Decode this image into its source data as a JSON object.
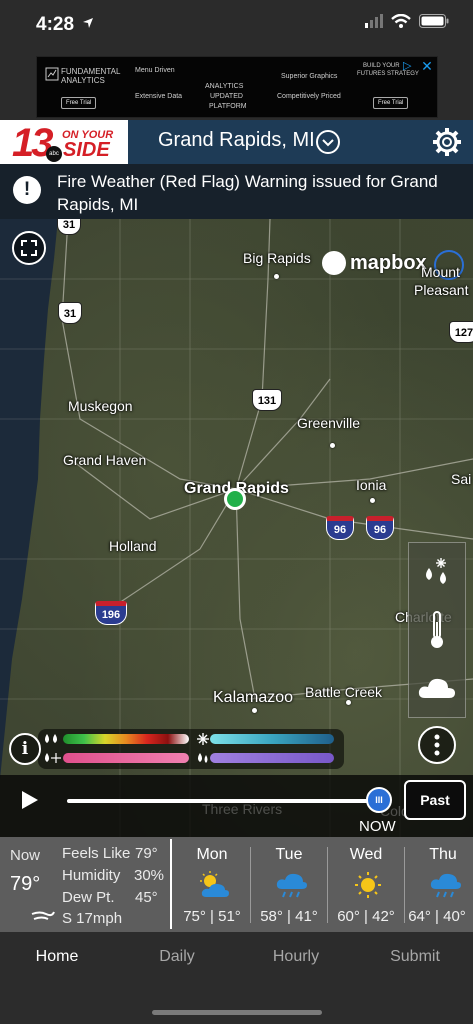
{
  "status_bar": {
    "time": "4:28"
  },
  "ad": {
    "brand_line1": "FUNDAMENTAL",
    "brand_line2": "ANALYTICS",
    "col1a": "Menu Driven",
    "col1b": "Extensive Data",
    "col2a": "ANALYTICS",
    "col2b": "UPDATED",
    "col2c": "PLATFORM",
    "col3a": "Superior Graphics",
    "col3b": "Competitively Priced",
    "col4a": "BUILD YOUR",
    "col4b": "FUTURES STRATEGY",
    "btn_left": "Free Trial",
    "btn_right": "Free Trial"
  },
  "header": {
    "logo_number": "13",
    "logo_network": "abc",
    "logo_line1": "ON YOUR",
    "logo_line2": "SIDE",
    "location": "Grand Rapids, MI"
  },
  "alert": {
    "text": "Fire Weather (Red Flag) Warning issued for Grand Rapids, MI"
  },
  "map": {
    "attribution": "mapbox",
    "cities": {
      "big_rapids": "Big Rapids",
      "mount_pleasant_1": "Mount",
      "mount_pleasant_2": "Pleasant",
      "muskegon": "Muskegon",
      "greenville": "Greenville",
      "grand_haven": "Grand Haven",
      "grand_rapids": "Grand Rapids",
      "ionia": "Ionia",
      "saint": "Sai",
      "holland": "Holland",
      "charlotte": "Charlotte",
      "kalamazoo": "Kalamazoo",
      "battle_creek": "Battle Creek",
      "three_rivers": "Three Rivers",
      "coldwater": "Coldwater"
    },
    "routes": {
      "us31_top": "31",
      "us31": "31",
      "us131": "131",
      "us127": "127",
      "i96_a": "96",
      "i96_b": "96",
      "i196": "196"
    }
  },
  "player": {
    "now_label": "NOW",
    "past_label": "Past",
    "thumb_label": "III"
  },
  "current": {
    "now_label": "Now",
    "temp": "79°",
    "feels_like_label": "Feels Like",
    "feels_like": "79°",
    "humidity_label": "Humidity",
    "humidity": "30%",
    "dew_pt_label": "Dew Pt.",
    "dew_pt": "45°",
    "wind": "S 17mph"
  },
  "forecast": [
    {
      "day": "Mon",
      "icon": "partly-sunny-icon",
      "hi": "75°",
      "lo": "51°"
    },
    {
      "day": "Tue",
      "icon": "rain-cloud-icon",
      "hi": "58°",
      "lo": "41°"
    },
    {
      "day": "Wed",
      "icon": "sun-icon",
      "hi": "60°",
      "lo": "42°"
    },
    {
      "day": "Thu",
      "icon": "rain-cloud-icon",
      "hi": "64°",
      "lo": "40°"
    }
  ],
  "tabs": [
    {
      "label": "Home"
    },
    {
      "label": "Daily"
    },
    {
      "label": "Hourly"
    },
    {
      "label": "Submit"
    }
  ],
  "colors": {
    "header_bg": "#1e3b56",
    "alert_bg": "#17212b",
    "brand_red": "#d51f26",
    "marker_green": "#22b04a",
    "slider_blue": "#2b6fd6"
  }
}
